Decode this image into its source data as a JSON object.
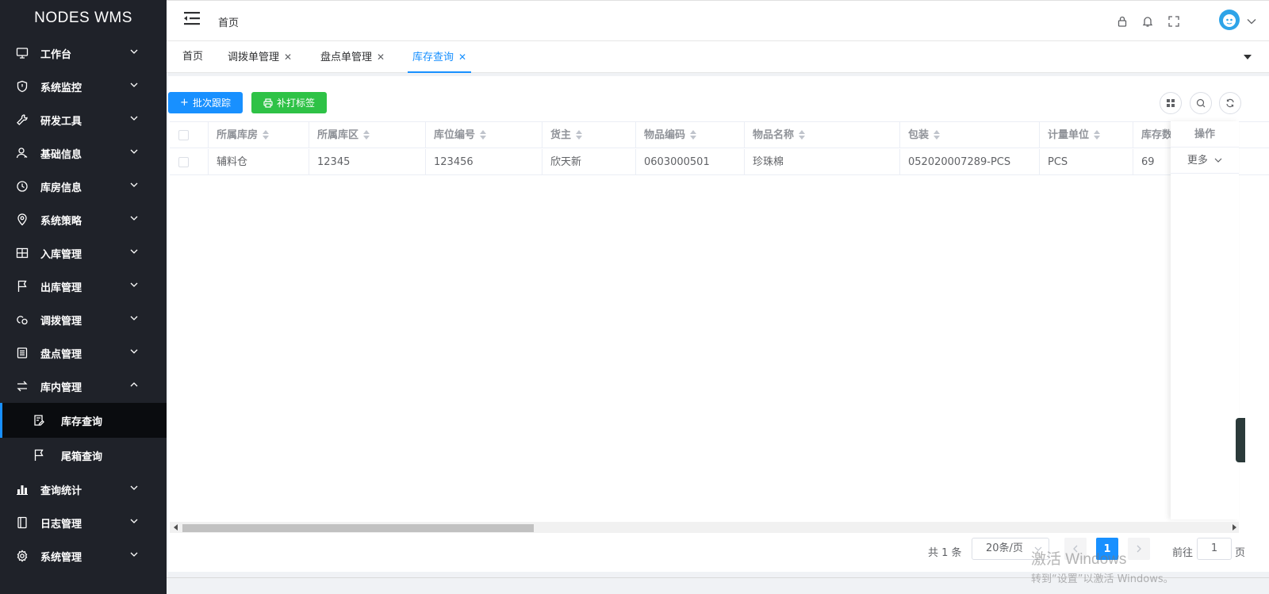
{
  "app": {
    "title": "NODES WMS"
  },
  "sidebar": {
    "items": [
      {
        "label": "工作台",
        "icon": "monitor-icon"
      },
      {
        "label": "系统监控",
        "icon": "shield-icon"
      },
      {
        "label": "研发工具",
        "icon": "wrench-icon"
      },
      {
        "label": "基础信息",
        "icon": "user-icon"
      },
      {
        "label": "库房信息",
        "icon": "clock-icon"
      },
      {
        "label": "系统策略",
        "icon": "location-icon"
      },
      {
        "label": "入库管理",
        "icon": "grid-icon"
      },
      {
        "label": "出库管理",
        "icon": "flag-icon"
      },
      {
        "label": "调拨管理",
        "icon": "transfer-icon"
      },
      {
        "label": "盘点管理",
        "icon": "list-icon"
      },
      {
        "label": "库内管理",
        "icon": "swap-icon",
        "expanded": true
      }
    ],
    "sub_items": [
      {
        "label": "库存查询",
        "icon": "edit-doc-icon",
        "active": true
      },
      {
        "label": "尾箱查询",
        "icon": "flag-icon"
      }
    ],
    "items_after": [
      {
        "label": "查询统计",
        "icon": "bar-chart-icon"
      },
      {
        "label": "日志管理",
        "icon": "log-icon"
      },
      {
        "label": "系统管理",
        "icon": "gear-icon"
      }
    ]
  },
  "header": {
    "breadcrumb": "首页",
    "icons": [
      "lock-icon",
      "bell-icon",
      "fullscreen-icon"
    ]
  },
  "tabs": [
    {
      "label": "首页",
      "closable": false
    },
    {
      "label": "调拨单管理",
      "closable": true
    },
    {
      "label": "盘点单管理",
      "closable": true
    },
    {
      "label": "库存查询",
      "closable": true,
      "active": true
    }
  ],
  "toolbar": {
    "batch_trace_label": "批次跟踪",
    "reprint_label": "补打标签"
  },
  "table": {
    "columns": [
      "所属库房",
      "所属库区",
      "库位编号",
      "货主",
      "物品编码",
      "物品名称",
      "包装",
      "计量单位",
      "库存数"
    ],
    "action_header": "操作",
    "rows": [
      {
        "cells": [
          "辅料仓",
          "12345",
          "123456",
          "欣天新",
          "0603000501",
          "珍珠棉",
          "052020007289-PCS",
          "PCS",
          "69"
        ],
        "action": "更多"
      }
    ]
  },
  "pagination": {
    "total_text": "共 1 条",
    "page_size": "20条/页",
    "current_page": "1",
    "goto_prefix": "前往",
    "goto_value": "1",
    "goto_suffix": "页"
  },
  "watermark": {
    "line1": "激活 Windows",
    "line2": "转到“设置”以激活 Windows。"
  },
  "colors": {
    "primary": "#1890ff",
    "success": "#2ec246",
    "sidebar_bg": "#1f2229"
  }
}
